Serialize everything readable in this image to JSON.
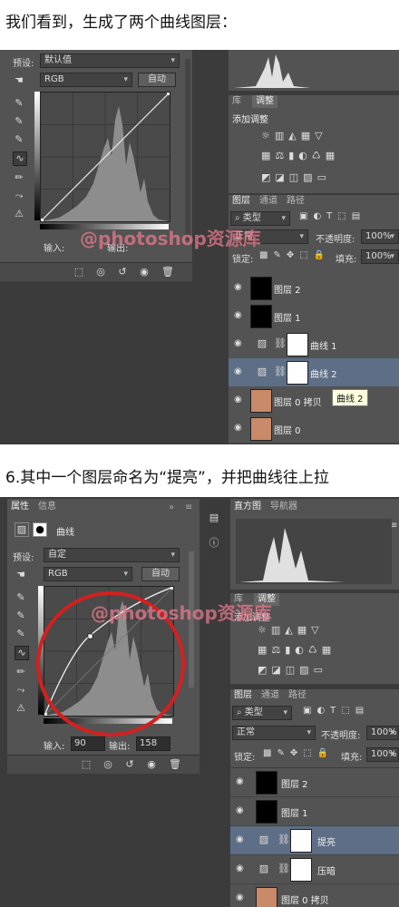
{
  "captions": {
    "top": "我们看到，生成了两个曲线图层：",
    "middle": "6.其中一个图层命名为“提亮”，并把曲线往上拉"
  },
  "watermark": "@photoshop资源库",
  "shot1": {
    "preset_label": "预设:",
    "preset_value": "默认值",
    "channel_value": "RGB",
    "auto_label": "自动",
    "input_label": "输入:",
    "output_label": "输出:",
    "tabs_adjust": [
      "库",
      "调整"
    ],
    "adjust_title": "添加调整",
    "tabs_layers": [
      "图层",
      "通道",
      "路径"
    ],
    "kind_filter": "类型",
    "blend_mode": "正常",
    "opacity_label": "不透明度:",
    "opacity_value": "100%",
    "lock_label": "锁定:",
    "fill_label": "填充:",
    "fill_value": "100%",
    "layers": [
      "图层 2",
      "图层 1",
      "曲线 1",
      "曲线 2",
      "图层 0 拷贝",
      "图层 0"
    ],
    "tooltip": "曲线 2"
  },
  "shot2": {
    "tabs_props": [
      "属性",
      "信息"
    ],
    "panel_title": "曲线",
    "preset_label": "预设:",
    "preset_value": "自定",
    "channel_value": "RGB",
    "auto_label": "自动",
    "input_label": "输入:",
    "input_value": "90",
    "output_label": "输出:",
    "output_value": "158",
    "tabs_hist": [
      "直方图",
      "导航器"
    ],
    "tabs_adjust": [
      "库",
      "调整"
    ],
    "adjust_title": "添加调整",
    "tabs_layers": [
      "图层",
      "通道",
      "路径"
    ],
    "kind_filter": "类型",
    "blend_mode": "正常",
    "opacity_label": "不透明度:",
    "opacity_value": "100%",
    "lock_label": "锁定:",
    "fill_label": "填充:",
    "fill_value": "100%",
    "layers": [
      "图层 2",
      "图层 1",
      "提亮",
      "压暗",
      "图层 0 拷贝"
    ]
  },
  "colors": {
    "selected_layer": "#5d6e86",
    "annotation_circle": "#d42020"
  }
}
